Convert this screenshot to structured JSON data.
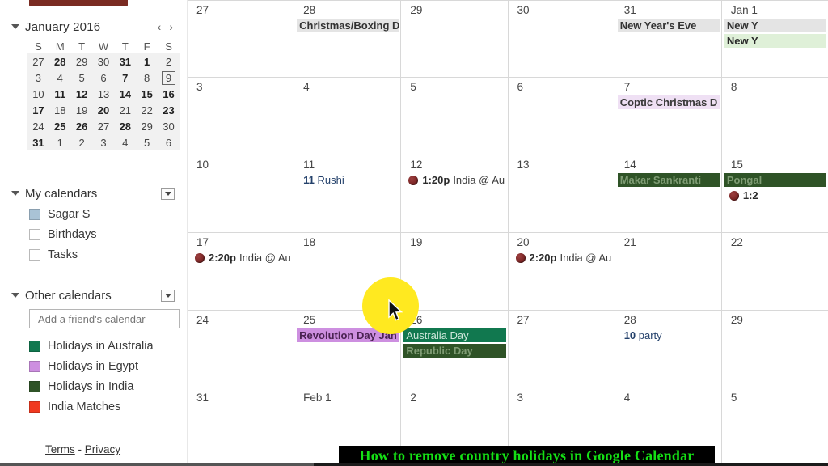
{
  "sidebar": {
    "create_button_label": "",
    "mini_calendar": {
      "title": "January 2016",
      "prev_label": "‹",
      "next_label": "›",
      "weekday_headers": [
        "S",
        "M",
        "T",
        "W",
        "T",
        "F",
        "S"
      ],
      "weeks": [
        [
          {
            "d": "27",
            "bold": false
          },
          {
            "d": "28",
            "bold": true
          },
          {
            "d": "29",
            "bold": false
          },
          {
            "d": "30",
            "bold": false
          },
          {
            "d": "31",
            "bold": true
          },
          {
            "d": "1",
            "bold": true
          },
          {
            "d": "2",
            "bold": false
          }
        ],
        [
          {
            "d": "3",
            "bold": false
          },
          {
            "d": "4",
            "bold": false
          },
          {
            "d": "5",
            "bold": false
          },
          {
            "d": "6",
            "bold": false
          },
          {
            "d": "7",
            "bold": true
          },
          {
            "d": "8",
            "bold": false
          },
          {
            "d": "9",
            "bold": false,
            "today": true
          }
        ],
        [
          {
            "d": "10",
            "bold": false
          },
          {
            "d": "11",
            "bold": true
          },
          {
            "d": "12",
            "bold": true
          },
          {
            "d": "13",
            "bold": false
          },
          {
            "d": "14",
            "bold": true
          },
          {
            "d": "15",
            "bold": true
          },
          {
            "d": "16",
            "bold": true
          }
        ],
        [
          {
            "d": "17",
            "bold": true
          },
          {
            "d": "18",
            "bold": false
          },
          {
            "d": "19",
            "bold": false
          },
          {
            "d": "20",
            "bold": true
          },
          {
            "d": "21",
            "bold": false
          },
          {
            "d": "22",
            "bold": false
          },
          {
            "d": "23",
            "bold": true
          }
        ],
        [
          {
            "d": "24",
            "bold": false
          },
          {
            "d": "25",
            "bold": true
          },
          {
            "d": "26",
            "bold": true
          },
          {
            "d": "27",
            "bold": false
          },
          {
            "d": "28",
            "bold": true
          },
          {
            "d": "29",
            "bold": false
          },
          {
            "d": "30",
            "bold": false
          }
        ],
        [
          {
            "d": "31",
            "bold": true
          },
          {
            "d": "1",
            "bold": false
          },
          {
            "d": "2",
            "bold": false
          },
          {
            "d": "3",
            "bold": false
          },
          {
            "d": "4",
            "bold": false
          },
          {
            "d": "5",
            "bold": false
          },
          {
            "d": "6",
            "bold": false
          }
        ]
      ]
    },
    "my_calendars": {
      "title": "My calendars",
      "items": [
        {
          "label": "Sagar S",
          "color": "#a9c3d6",
          "checked": true
        },
        {
          "label": "Birthdays",
          "color": "",
          "checked": false
        },
        {
          "label": "Tasks",
          "color": "",
          "checked": false
        }
      ]
    },
    "other_calendars": {
      "title": "Other calendars",
      "add_friend_placeholder": "Add a friend's calendar",
      "add_friend_value": "",
      "items": [
        {
          "label": "Holidays in Australia",
          "color": "#11784f",
          "checked": true
        },
        {
          "label": "Holidays in Egypt",
          "color": "#cd8fe0",
          "checked": true
        },
        {
          "label": "Holidays in India",
          "color": "#2f5327",
          "checked": true
        },
        {
          "label": "India Matches",
          "color": "#f03a20",
          "checked": true
        }
      ]
    },
    "footer": {
      "terms": "Terms",
      "separator": " - ",
      "privacy": "Privacy"
    }
  },
  "grid": {
    "weeks": [
      [
        {
          "day": "27",
          "events": []
        },
        {
          "day": "28",
          "events": [
            {
              "text": "Christmas/Boxing D",
              "style": "grey"
            }
          ]
        },
        {
          "day": "29",
          "events": []
        },
        {
          "day": "30",
          "events": []
        },
        {
          "day": "31",
          "events": [
            {
              "text": "New Year's Eve",
              "style": "grey"
            }
          ]
        },
        {
          "day": "Jan 1",
          "events": [
            {
              "text": "New Y",
              "style": "grey"
            },
            {
              "text": "New Y",
              "style": "lightgreen"
            }
          ]
        }
      ],
      [
        {
          "day": "3",
          "events": []
        },
        {
          "day": "4",
          "events": []
        },
        {
          "day": "5",
          "events": []
        },
        {
          "day": "6",
          "events": []
        },
        {
          "day": "7",
          "events": [
            {
              "text": "Coptic Christmas D",
              "style": "purple"
            }
          ]
        },
        {
          "day": "8",
          "events": []
        }
      ],
      [
        {
          "day": "10",
          "events": []
        },
        {
          "day": "11",
          "events": [
            {
              "text": "Rushi",
              "style": "plain",
              "time": "11"
            }
          ]
        },
        {
          "day": "12",
          "events": [
            {
              "text": "India @ Au",
              "style": "cricket",
              "time": "1:20p"
            }
          ]
        },
        {
          "day": "13",
          "events": []
        },
        {
          "day": "14",
          "events": [
            {
              "text": "Makar Sankranti",
              "style": "darkgreen"
            }
          ]
        },
        {
          "day": "15",
          "events": [
            {
              "text": "Pongal",
              "style": "darkgreen"
            },
            {
              "text": "",
              "style": "cricket",
              "time": "1:2"
            }
          ]
        }
      ],
      [
        {
          "day": "17",
          "events": [
            {
              "text": "India @ Au",
              "style": "cricket",
              "time": "2:20p"
            }
          ]
        },
        {
          "day": "18",
          "events": []
        },
        {
          "day": "19",
          "events": []
        },
        {
          "day": "20",
          "events": [
            {
              "text": "India @ Au",
              "style": "cricket",
              "time": "2:20p"
            }
          ]
        },
        {
          "day": "21",
          "events": []
        },
        {
          "day": "22",
          "events": []
        }
      ],
      [
        {
          "day": "24",
          "events": []
        },
        {
          "day": "25",
          "events": [
            {
              "text": "Revolution Day Jan",
              "style": "purple-strong"
            }
          ]
        },
        {
          "day": "26",
          "events": [
            {
              "text": "Australia Day",
              "style": "teal"
            },
            {
              "text": "Republic Day",
              "style": "darkgreen"
            }
          ]
        },
        {
          "day": "27",
          "events": []
        },
        {
          "day": "28",
          "events": [
            {
              "text": "party",
              "style": "plain",
              "time": "10"
            }
          ]
        },
        {
          "day": "29",
          "events": []
        }
      ],
      [
        {
          "day": "31",
          "events": []
        },
        {
          "day": "Feb 1",
          "events": []
        },
        {
          "day": "2",
          "events": []
        },
        {
          "day": "3",
          "events": []
        },
        {
          "day": "4",
          "events": []
        },
        {
          "day": "5",
          "events": []
        }
      ]
    ]
  },
  "overlay": {
    "caption_text": "How to remove country holidays in Google Calendar",
    "caption_color": "#15e015",
    "caption_bg": "#000000"
  }
}
